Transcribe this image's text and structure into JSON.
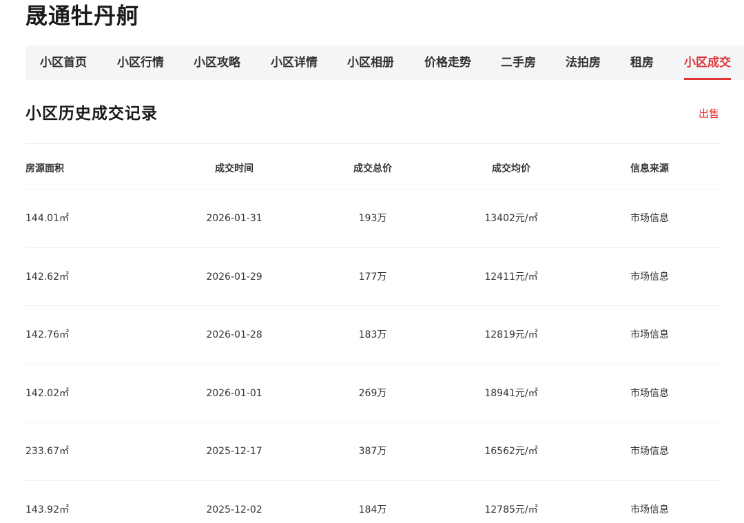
{
  "page": {
    "title": "晟通牡丹舸"
  },
  "nav": {
    "items": [
      {
        "label": "小区首页"
      },
      {
        "label": "小区行情"
      },
      {
        "label": "小区攻略"
      },
      {
        "label": "小区详情"
      },
      {
        "label": "小区相册"
      },
      {
        "label": "价格走势"
      },
      {
        "label": "二手房"
      },
      {
        "label": "法拍房"
      },
      {
        "label": "租房"
      },
      {
        "label": "小区成交"
      }
    ],
    "active": "小区成交"
  },
  "section": {
    "title": "小区历史成交记录",
    "sell_link": "出售"
  },
  "table": {
    "headers": [
      "房源面积",
      "成交时间",
      "成交总价",
      "成交均价",
      "信息来源"
    ],
    "rows": [
      [
        "144.01㎡",
        "2026-01-31",
        "193万",
        "13402元/㎡",
        "市场信息"
      ],
      [
        "142.62㎡",
        "2026-01-29",
        "177万",
        "12411元/㎡",
        "市场信息"
      ],
      [
        "142.76㎡",
        "2026-01-28",
        "183万",
        "12819元/㎡",
        "市场信息"
      ],
      [
        "142.02㎡",
        "2026-01-01",
        "269万",
        "18941元/㎡",
        "市场信息"
      ],
      [
        "233.67㎡",
        "2025-12-17",
        "387万",
        "16562元/㎡",
        "市场信息"
      ],
      [
        "143.92㎡",
        "2025-12-02",
        "184万",
        "12785元/㎡",
        "市场信息"
      ]
    ]
  },
  "colors": {
    "accent": "#e03535",
    "nav_background": "#f4f5f7",
    "text": "#333333"
  }
}
